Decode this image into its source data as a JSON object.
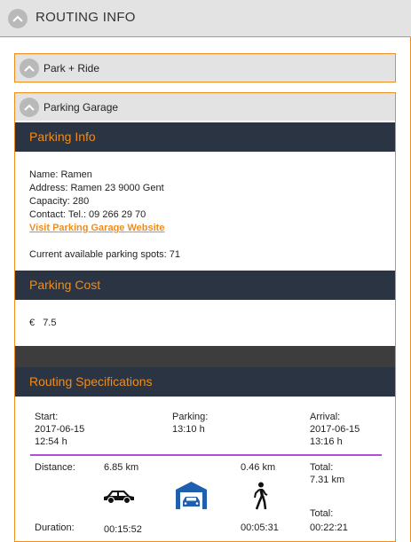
{
  "header": {
    "title": "ROUTING INFO"
  },
  "accordions": {
    "park_ride": {
      "label": "Park + Ride"
    },
    "parking_garage": {
      "label": "Parking Garage"
    }
  },
  "parking_info": {
    "heading": "Parking Info",
    "name": "Name: Ramen",
    "address": "Address: Ramen 23 9000 Gent",
    "capacity": "Capacity: 280",
    "contact": "Contact: Tel.: 09 266 29 70",
    "link": "Visit Parking Garage Website",
    "available": "Current available parking spots: 71"
  },
  "parking_cost": {
    "heading": "Parking Cost",
    "currency": "€",
    "amount": "7.5"
  },
  "routing_specs": {
    "heading": "Routing Specifications",
    "start_label": "Start:",
    "start_date": "2017-06-15",
    "start_time": "12:54 h",
    "parking_label": "Parking:",
    "parking_time": "13:10 h",
    "arrival_label": "Arrival:",
    "arrival_date": "2017-06-15",
    "arrival_time": "13:16 h",
    "distance_label": "Distance:",
    "car_distance": "6.85 km",
    "walk_distance": "0.46 km",
    "total_label": "Total:",
    "total_distance": "7.31 km",
    "duration_label": "Duration:",
    "car_duration": "00:15:52",
    "walk_duration": "00:05:31",
    "total_label_2": "Total:",
    "total_duration": "00:22:21"
  },
  "colors": {
    "accent": "#f08c1a",
    "dark_header": "#2b3443",
    "garage_icon": "#1f5fb0",
    "route_line": "#b24fd6"
  },
  "icons": {
    "chevron": "chevron-up-icon",
    "car": "car-icon",
    "garage": "parking-garage-icon",
    "walk": "walking-person-icon"
  }
}
